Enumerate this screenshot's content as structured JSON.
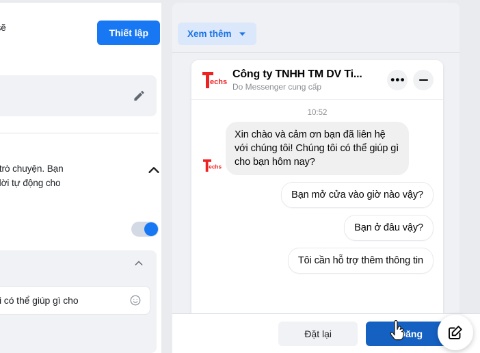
{
  "left_panel": {
    "setup_description": "chat, chúng tôi sẽ\nình.",
    "setup_button": "Thiết lập",
    "edit_icon": "pencil-icon",
    "collapse_description": "ắt đầu cuộc trò chuyện. Bạn\nchỉnh tin trả lời tự động cho",
    "collapse_icon": "chevron-up-icon",
    "toggle_on": true,
    "card_collapse_icon": "chevron-up-icon",
    "message_input_value": "húng tôi có thể giúp gì cho",
    "emoji_icon": "smiley-icon"
  },
  "right_panel": {
    "see_more_button": "Xem thêm",
    "see_more_chevron": "chevron-down-icon",
    "chat": {
      "avatar_icon": "techsr-logo",
      "title": "Công ty TNHH TM DV Ti...",
      "subtitle": "Do Messenger cung cấp",
      "menu_icon": "more-options-icon",
      "minimize_icon": "minimize-icon",
      "timestamp": "10:52",
      "messages": [
        {
          "direction": "in",
          "text": "Xin chào và cảm ơn bạn đã liên hệ với chúng tôi! Chúng tôi có thể giúp gì cho bạn hôm nay?",
          "avatar": true
        },
        {
          "direction": "out",
          "text": "Bạn mở cửa vào giờ nào vậy?"
        },
        {
          "direction": "out",
          "text": "Bạn ở đâu vậy?"
        },
        {
          "direction": "out",
          "text": "Tôi cần hỗ trợ thêm thông tin",
          "clipped": true
        }
      ]
    }
  },
  "bottom_bar": {
    "reset_button": "Đặt lại",
    "publish_button": "Đăng"
  },
  "fab": {
    "compose_icon": "compose-edit-icon"
  },
  "colors": {
    "brand_blue": "#1877f2",
    "publish_blue": "#1461c2",
    "see_more_bg": "#dbe7fb",
    "see_more_text": "#1b74e4",
    "page_bg": "#e9ebee",
    "panel_bg": "#eff1f5",
    "bubble_in": "#f1f0f0",
    "logo_red": "#ee2222"
  }
}
